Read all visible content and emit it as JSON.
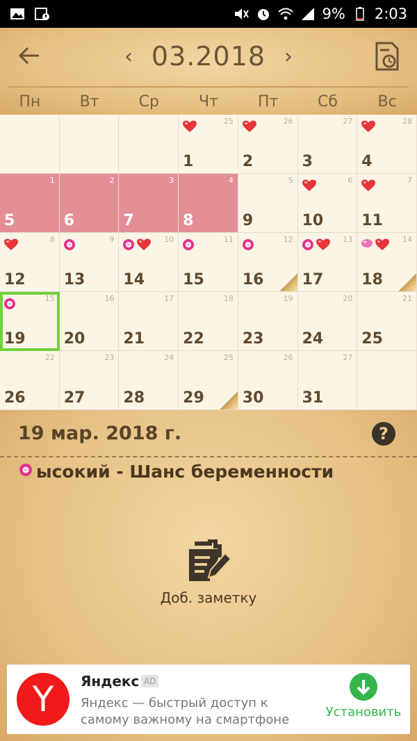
{
  "status_bar": {
    "battery": "9%",
    "time": "2:03",
    "icons": [
      "gallery-icon",
      "calendar-notification-icon",
      "mute-icon",
      "alarm-icon",
      "wifi-icon",
      "signal-icon",
      "battery-icon"
    ]
  },
  "header": {
    "month": "03.2018",
    "prev": "‹",
    "next": "›",
    "weekdays": [
      "Пн",
      "Вт",
      "Ср",
      "Чт",
      "Пт",
      "Сб",
      "Вс"
    ]
  },
  "calendar": {
    "rows": [
      [
        {
          "day": "",
          "cycle": ""
        },
        {
          "day": "",
          "cycle": ""
        },
        {
          "day": "",
          "cycle": ""
        },
        {
          "day": "1",
          "cycle": "25",
          "marks": [
            "heart"
          ]
        },
        {
          "day": "2",
          "cycle": "26",
          "marks": [
            "heart"
          ]
        },
        {
          "day": "3",
          "cycle": "27"
        },
        {
          "day": "4",
          "cycle": "28",
          "marks": [
            "heart"
          ]
        }
      ],
      [
        {
          "day": "5",
          "cycle": "1",
          "period": true
        },
        {
          "day": "6",
          "cycle": "2",
          "period": true
        },
        {
          "day": "7",
          "cycle": "3",
          "period": true
        },
        {
          "day": "8",
          "cycle": "4",
          "period": true
        },
        {
          "day": "9",
          "cycle": "5"
        },
        {
          "day": "10",
          "cycle": "6",
          "marks": [
            "heart"
          ]
        },
        {
          "day": "11",
          "cycle": "7",
          "marks": [
            "heart"
          ]
        }
      ],
      [
        {
          "day": "12",
          "cycle": "8",
          "marks": [
            "heart"
          ]
        },
        {
          "day": "13",
          "cycle": "9",
          "marks": [
            "flower"
          ]
        },
        {
          "day": "14",
          "cycle": "10",
          "marks": [
            "flower",
            "heart"
          ]
        },
        {
          "day": "15",
          "cycle": "11",
          "marks": [
            "flower"
          ]
        },
        {
          "day": "16",
          "cycle": "12",
          "marks": [
            "flower"
          ],
          "note": true
        },
        {
          "day": "17",
          "cycle": "13",
          "marks": [
            "flower",
            "heart"
          ]
        },
        {
          "day": "18",
          "cycle": "14",
          "marks": [
            "oval",
            "heart"
          ],
          "note": true
        }
      ],
      [
        {
          "day": "19",
          "cycle": "15",
          "marks": [
            "flower"
          ],
          "selected": true
        },
        {
          "day": "20",
          "cycle": "16"
        },
        {
          "day": "21",
          "cycle": "17"
        },
        {
          "day": "22",
          "cycle": "18"
        },
        {
          "day": "23",
          "cycle": "19"
        },
        {
          "day": "24",
          "cycle": "20"
        },
        {
          "day": "25",
          "cycle": "21"
        }
      ],
      [
        {
          "day": "26",
          "cycle": "22"
        },
        {
          "day": "27",
          "cycle": "23"
        },
        {
          "day": "28",
          "cycle": "24"
        },
        {
          "day": "29",
          "cycle": "25",
          "note": true
        },
        {
          "day": "30",
          "cycle": "26"
        },
        {
          "day": "31",
          "cycle": "27"
        },
        {
          "day": "",
          "cycle": ""
        }
      ]
    ]
  },
  "details": {
    "date": "19 мар. 2018 г.",
    "help": "?",
    "chance": "ысокий - Шанс беременности",
    "add_note": "Доб. заметку"
  },
  "ad": {
    "logo": "Y",
    "title": "Яндекс",
    "badge": "AD",
    "description": "Яндекс — быстрый доступ к самому важному на смартфоне",
    "install": "Установить"
  },
  "colors": {
    "period": "#e38d95",
    "selected_outline": "#6fd23a",
    "heart": "#e8353a",
    "flower": "#e5348c",
    "install_green": "#35b44b"
  }
}
